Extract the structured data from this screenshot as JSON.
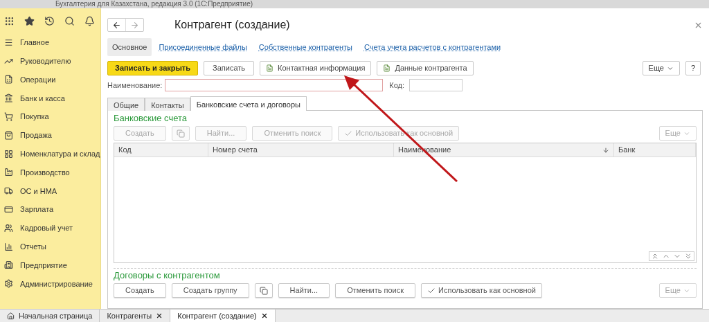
{
  "window": {
    "title": "Бухгалтерия для Казахстана, редакция 3.0 (1С:Предприятие)"
  },
  "sidebar": {
    "items": [
      {
        "label": "Главное"
      },
      {
        "label": "Руководителю"
      },
      {
        "label": "Операции"
      },
      {
        "label": "Банк и касса"
      },
      {
        "label": "Покупка"
      },
      {
        "label": "Продажа"
      },
      {
        "label": "Номенклатура и склад"
      },
      {
        "label": "Производство"
      },
      {
        "label": "ОС и НМА"
      },
      {
        "label": "Зарплата"
      },
      {
        "label": "Кадровый учет"
      },
      {
        "label": "Отчеты"
      },
      {
        "label": "Предприятие"
      },
      {
        "label": "Администрирование"
      }
    ]
  },
  "form": {
    "title": "Контрагент (создание)",
    "nav_links": [
      {
        "label": "Основное",
        "selected": true
      },
      {
        "label": "Присоединенные файлы",
        "selected": false
      },
      {
        "label": "Собственные контрагенты",
        "selected": false
      },
      {
        "label": "Счета учета расчетов с контрагентами",
        "selected": false
      }
    ],
    "toolbar": [
      {
        "label": "Записать и закрыть",
        "kind": "primary"
      },
      {
        "label": "Записать",
        "kind": "plain"
      },
      {
        "label": "Контактная информация",
        "kind": "doc"
      },
      {
        "label": "Данные контрагента",
        "kind": "doc"
      }
    ],
    "more_button": "Еще",
    "help_button": "?",
    "name_label": "Наименование:",
    "code_label": "Код:",
    "tabs": [
      {
        "label": "Общие",
        "selected": false
      },
      {
        "label": "Контакты",
        "selected": false
      },
      {
        "label": "Банковские счета и договоры",
        "selected": true
      }
    ],
    "bank_accounts": {
      "title": "Банковские счета",
      "buttons": [
        {
          "label": "Создать",
          "kind": "text",
          "disabled": true
        },
        {
          "kind": "copy",
          "disabled": true
        },
        {
          "label": "Найти...",
          "kind": "text",
          "disabled": true
        },
        {
          "label": "Отменить поиск",
          "kind": "text",
          "disabled": true
        },
        {
          "label": "Использовать как основной",
          "kind": "check",
          "disabled": true
        }
      ],
      "more_button": "Еще",
      "columns": [
        {
          "label": "Код",
          "sorted": false
        },
        {
          "label": "Номер счета",
          "sorted": false
        },
        {
          "label": "Наименование",
          "sorted": true
        },
        {
          "label": "Банк",
          "sorted": false
        }
      ]
    },
    "contracts": {
      "title": "Договоры с контрагентом",
      "buttons": [
        {
          "label": "Создать",
          "kind": "text",
          "disabled": false
        },
        {
          "label": "Создать группу",
          "kind": "text",
          "disabled": false
        },
        {
          "kind": "copy",
          "disabled": false
        },
        {
          "label": "Найти...",
          "kind": "text",
          "disabled": false
        },
        {
          "label": "Отменить поиск",
          "kind": "text",
          "disabled": false
        },
        {
          "label": "Использовать как основной",
          "kind": "check",
          "disabled": false
        }
      ],
      "more_button": "Еще"
    }
  },
  "taskbar": [
    {
      "label": "Начальная страница",
      "kind": "home",
      "selected": false
    },
    {
      "label": "Контрагенты",
      "kind": "closable",
      "selected": false
    },
    {
      "label": "Контрагент (создание)",
      "kind": "closable",
      "selected": true
    }
  ]
}
